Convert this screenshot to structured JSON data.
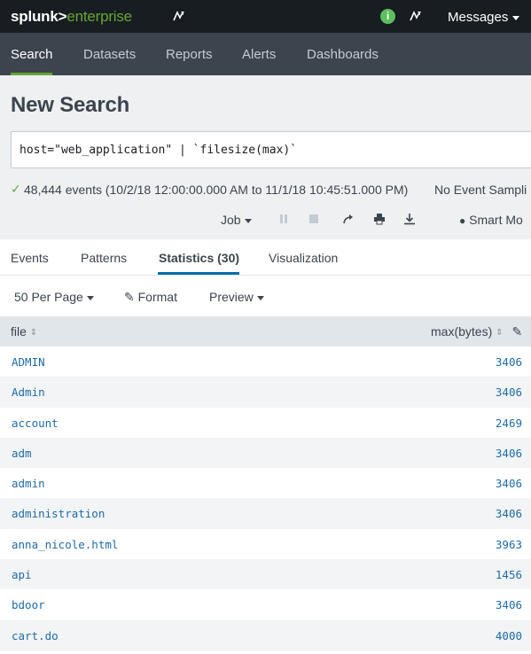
{
  "topbar": {
    "logo_primary": "splunk>",
    "logo_secondary": "enterprise",
    "messages_label": "Messages",
    "info_glyph": "i"
  },
  "nav": {
    "items": [
      {
        "label": "Search",
        "active": true
      },
      {
        "label": "Datasets"
      },
      {
        "label": "Reports"
      },
      {
        "label": "Alerts"
      },
      {
        "label": "Dashboards"
      }
    ]
  },
  "page": {
    "title": "New Search",
    "query": "host=\"web_application\" | `filesize(max)`",
    "status_count": "48,444 events (10/2/18 12:00:00.000 AM to 11/1/18 10:45:51.000 PM)",
    "status_right": "No Event Sampli",
    "job_label": "Job",
    "smart_mode": "Smart Mo"
  },
  "results": {
    "tabs": [
      {
        "label": "Events"
      },
      {
        "label": "Patterns"
      },
      {
        "label": "Statistics (30)",
        "active": true
      },
      {
        "label": "Visualization"
      }
    ],
    "options": {
      "per_page": "50 Per Page",
      "format": "Format",
      "preview": "Preview"
    },
    "columns": [
      "file",
      "max(bytes)"
    ],
    "rows": [
      {
        "file": "ADMIN",
        "max": "3406"
      },
      {
        "file": "Admin",
        "max": "3406"
      },
      {
        "file": "account",
        "max": "2469"
      },
      {
        "file": "adm",
        "max": "3406"
      },
      {
        "file": "admin",
        "max": "3406"
      },
      {
        "file": "administration",
        "max": "3406"
      },
      {
        "file": "anna_nicole.html",
        "max": "3963"
      },
      {
        "file": "api",
        "max": "1456"
      },
      {
        "file": "bdoor",
        "max": "3406"
      },
      {
        "file": "cart.do",
        "max": "4000"
      }
    ]
  },
  "colors": {
    "brand_green": "#65a637",
    "nav_bg": "#3c444d",
    "topbar_bg": "#171d21",
    "link_blue": "#1e6ba8",
    "tab_accent": "#006eaa"
  },
  "icons": [
    "activity-icon",
    "info-icon",
    "caret-down-icon",
    "pause-icon",
    "stop-icon",
    "share-icon",
    "print-icon",
    "export-icon",
    "lightbulb-icon",
    "sort-icon",
    "pencil-icon",
    "check-icon"
  ]
}
